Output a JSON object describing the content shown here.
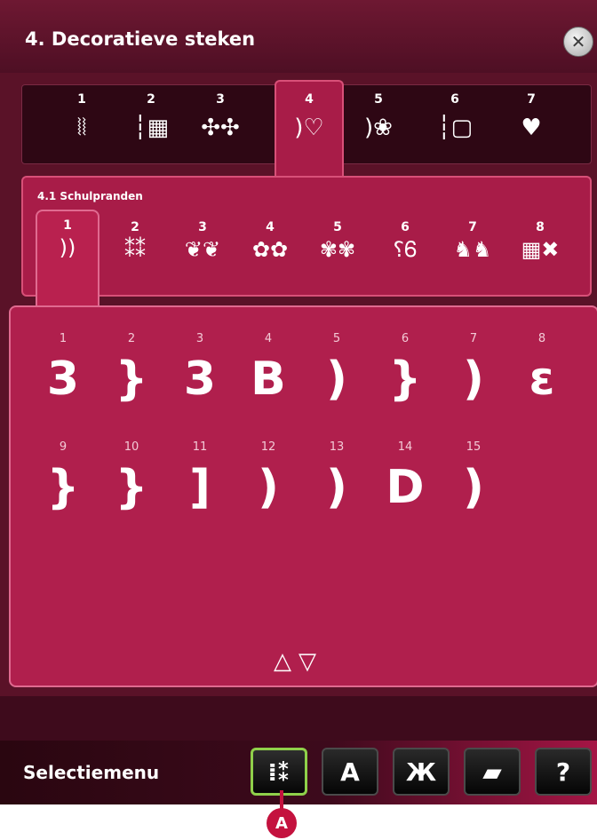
{
  "header": {
    "title": "4. Decoratieve steken",
    "close_icon": "close-icon"
  },
  "categories": [
    {
      "num": "1",
      "icon": "⦚⦚"
    },
    {
      "num": "2",
      "icon": "┆▦"
    },
    {
      "num": "3",
      "icon": "✣✣"
    },
    {
      "num": "4",
      "icon": ")♡"
    },
    {
      "num": "5",
      "icon": ")❀"
    },
    {
      "num": "6",
      "icon": "┆▢"
    },
    {
      "num": "7",
      "icon": "♥"
    }
  ],
  "active_category": "4",
  "subcategory": {
    "label": "4.1 Schulpranden",
    "tabs": [
      {
        "num": "1",
        "icon": "))"
      },
      {
        "num": "2",
        "icon": "⁑⁑"
      },
      {
        "num": "3",
        "icon": "❦❦"
      },
      {
        "num": "4",
        "icon": "✿✿"
      },
      {
        "num": "5",
        "icon": "✾✾"
      },
      {
        "num": "6",
        "icon": "⸮Ꮾ"
      },
      {
        "num": "7",
        "icon": "♞♞"
      },
      {
        "num": "8",
        "icon": "▦✖"
      }
    ],
    "active_tab": "1"
  },
  "stitches": [
    {
      "num": "1",
      "glyph": "3"
    },
    {
      "num": "2",
      "glyph": "}"
    },
    {
      "num": "3",
      "glyph": "3"
    },
    {
      "num": "4",
      "glyph": "B"
    },
    {
      "num": "5",
      "glyph": ")"
    },
    {
      "num": "6",
      "glyph": "}"
    },
    {
      "num": "7",
      "glyph": ")"
    },
    {
      "num": "8",
      "glyph": "ɛ"
    },
    {
      "num": "9",
      "glyph": "}"
    },
    {
      "num": "10",
      "glyph": "}"
    },
    {
      "num": "11",
      "glyph": "]"
    },
    {
      "num": "12",
      "glyph": ")"
    },
    {
      "num": "13",
      "glyph": ")"
    },
    {
      "num": "14",
      "glyph": "D"
    },
    {
      "num": "15",
      "glyph": ")"
    }
  ],
  "scroll": {
    "up_icon": "scroll-up-icon",
    "down_icon": "scroll-down-icon"
  },
  "bottombar": {
    "label": "Selectiemenu",
    "buttons": [
      {
        "name": "stitch-menu-button",
        "glyph": "⁞⁑"
      },
      {
        "name": "font-menu-button",
        "glyph": "A"
      },
      {
        "name": "embroidery-menu-button",
        "glyph": "Ж"
      },
      {
        "name": "file-manager-button",
        "glyph": "▰"
      },
      {
        "name": "help-button",
        "glyph": "?"
      }
    ]
  },
  "marker": {
    "label": "A"
  }
}
